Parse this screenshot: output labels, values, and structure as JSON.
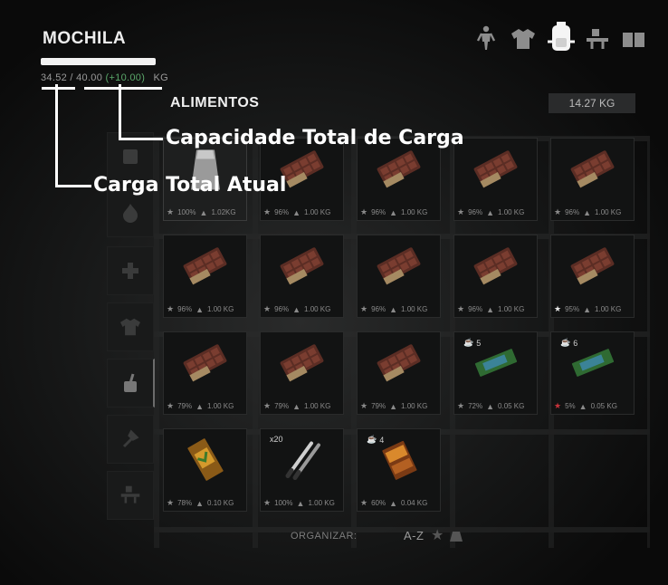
{
  "panel": {
    "title": "MOCHILA"
  },
  "weights": {
    "current": "34.52",
    "separator": "/",
    "capacity": "40.00",
    "bonus": "(+10.00)",
    "unit": "KG"
  },
  "category": {
    "name": "ALIMENTOS",
    "weight": "14.27 KG"
  },
  "nav_icons": [
    "player-status-icon",
    "clothing-icon",
    "backpack-icon",
    "crafting-icon",
    "journal-icon"
  ],
  "side_icons": [
    "all-icon",
    "fire-icon",
    "first-aid-icon",
    "clothing-icon",
    "food-icon",
    "tools-icon",
    "materials-icon"
  ],
  "items": [
    {
      "kind": "bag",
      "cond": "100%",
      "weight": "1.02KG"
    },
    {
      "kind": "chocolate",
      "cond": "96%",
      "weight": "1.00 KG"
    },
    {
      "kind": "chocolate",
      "cond": "96%",
      "weight": "1.00 KG"
    },
    {
      "kind": "chocolate",
      "cond": "96%",
      "weight": "1.00 KG"
    },
    {
      "kind": "chocolate",
      "cond": "96%",
      "weight": "1.00 KG"
    },
    {
      "kind": "chocolate",
      "cond": "96%",
      "weight": "1.00 KG"
    },
    {
      "kind": "chocolate",
      "cond": "96%",
      "weight": "1.00 KG"
    },
    {
      "kind": "chocolate",
      "cond": "96%",
      "weight": "1.00 KG"
    },
    {
      "kind": "chocolate",
      "cond": "96%",
      "weight": "1.00 KG"
    },
    {
      "kind": "chocolate",
      "cond": "95%",
      "weight": "1.00 KG",
      "star": "white"
    },
    {
      "kind": "chocolate",
      "cond": "79%",
      "weight": "1.00 KG"
    },
    {
      "kind": "chocolate",
      "cond": "79%",
      "weight": "1.00 KG"
    },
    {
      "kind": "chocolate",
      "cond": "79%",
      "weight": "1.00 KG"
    },
    {
      "kind": "bar-green",
      "cond": "72%",
      "weight": "0.05 KG",
      "tag": "5"
    },
    {
      "kind": "bar-green",
      "cond": "5%",
      "weight": "0.05 KG",
      "tag": "6",
      "star": "red"
    },
    {
      "kind": "candy",
      "cond": "78%",
      "weight": "0.10 KG"
    },
    {
      "kind": "sticks",
      "cond": "100%",
      "weight": "1.00 KG",
      "count": "x20"
    },
    {
      "kind": "candy-orange",
      "cond": "60%",
      "weight": "0.04 KG",
      "tag": "4"
    }
  ],
  "sort": {
    "label": "ORGANIZAR:",
    "az": "A-Z"
  },
  "annotations": {
    "capacity": "Capacidade Total de Carga",
    "current": "Carga Total Atual"
  }
}
